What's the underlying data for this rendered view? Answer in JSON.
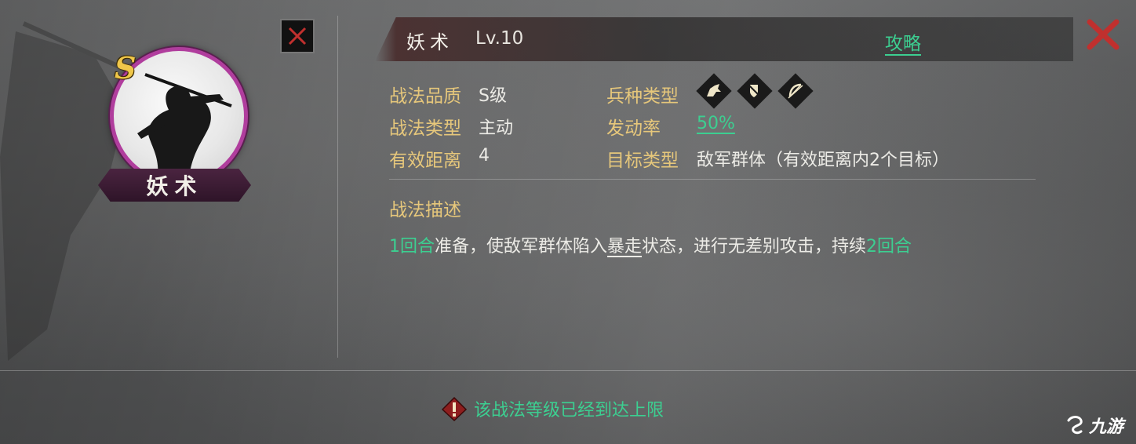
{
  "skill": {
    "name": "妖术",
    "level": "Lv.10",
    "grade": "S",
    "guide_label": "攻略"
  },
  "attributes": {
    "quality_label": "战法品质",
    "quality_value": "S级",
    "type_label": "战法类型",
    "type_value": "主动",
    "range_label": "有效距离",
    "range_value": "4",
    "troop_label": "兵种类型",
    "troop_icons": [
      "cavalry-icon",
      "shield-infantry-icon",
      "archer-icon"
    ],
    "rate_label": "发动率",
    "rate_value": "50%",
    "target_label": "目标类型",
    "target_value": "敌军群体（有效距离内2个目标）"
  },
  "description": {
    "title": "战法描述",
    "prep": "1回合",
    "text1": "准备，使敌军群体陷入",
    "status": "暴走",
    "text2": "状态，进行无差别攻击，持续",
    "duration": "2回合"
  },
  "notice": {
    "text": "该战法等级已经到达上限"
  },
  "watermark": {
    "text": "九游"
  },
  "colors": {
    "accent_green": "#3ccf91",
    "label_gold": "#e6c77b",
    "frame_purple": "#b03d9d",
    "close_red": "#c0302e"
  }
}
